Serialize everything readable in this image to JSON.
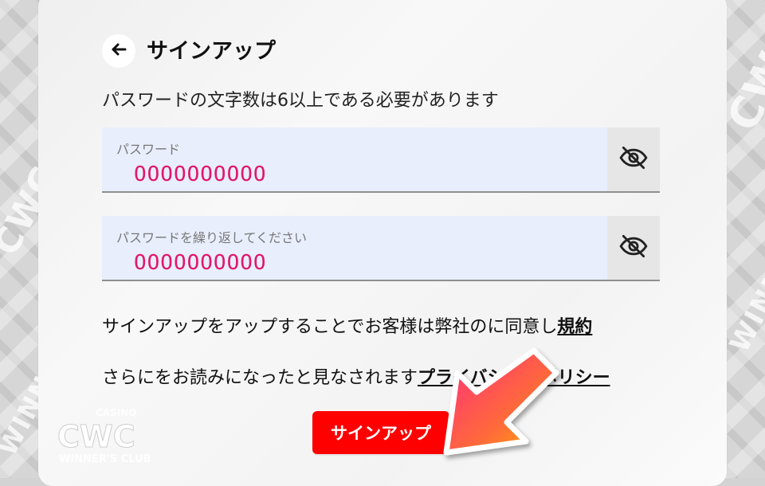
{
  "header": {
    "title": "サインアップ"
  },
  "form": {
    "requirement_text": "パスワードの文字数は6以上である必要があります",
    "fields": [
      {
        "label": "パスワード",
        "value": "OOOOOOOOOO"
      },
      {
        "label": "パスワードを繰り返してください",
        "value": "OOOOOOOOOO"
      }
    ]
  },
  "terms": {
    "line1_text": "サインアップをアップすることでお客様は弊社のに同意し",
    "line1_link": "規約",
    "line2_text": "さらにをお読みになったと見なされます",
    "line2_link": "プライバシー・ポリシー"
  },
  "actions": {
    "signup_label": "サインアップ"
  },
  "watermark": {
    "top": "CASINO",
    "main": "CWC",
    "sub": "WINNER'S CLUB"
  },
  "colors": {
    "accent": "#ff0000",
    "field_bg": "#e8eefc",
    "field_value": "#e2166b"
  },
  "icons": {
    "back": "arrow-left-icon",
    "eye": "eye-off-icon",
    "overlay_arrow": "pointer-arrow-icon"
  }
}
